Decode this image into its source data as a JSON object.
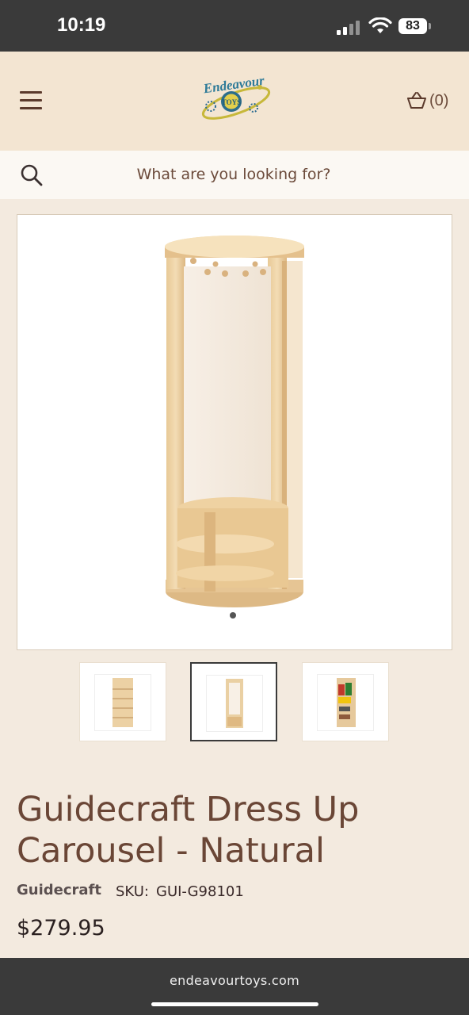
{
  "status_bar": {
    "time": "10:19",
    "battery": "83",
    "icons": [
      "signal-icon",
      "wifi-icon",
      "battery-icon"
    ]
  },
  "header": {
    "logo_text": "Endeavour TOYS",
    "cart_count": "(0)",
    "icons": [
      "menu-icon",
      "cart-basket-icon"
    ]
  },
  "search": {
    "placeholder": "What are you looking for?",
    "icon": "search-icon"
  },
  "product": {
    "title": "Guidecraft Dress Up Carousel - Natural",
    "vendor": "Guidecraft",
    "sku_label": "SKU:",
    "sku": "GUI-G98101",
    "price": "$279.95",
    "thumbnails": [
      {
        "name": "thumb-shelves-side",
        "selected": false
      },
      {
        "name": "thumb-mirror-front",
        "selected": true
      },
      {
        "name": "thumb-with-clothes",
        "selected": false
      }
    ]
  },
  "browser": {
    "url": "endeavourtoys.com"
  },
  "colors": {
    "header_bg": "#f3e5d2",
    "page_bg": "#f3eadf",
    "title": "#6a4636",
    "status_bar": "#3a3a3a"
  }
}
